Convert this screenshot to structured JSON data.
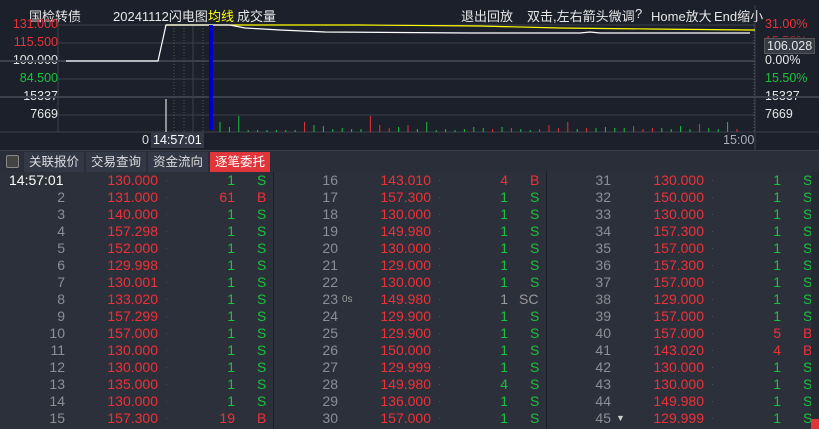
{
  "header": {
    "name": "国检转债",
    "date_title": "20241112闪电图",
    "avg_line_label": "均线",
    "volume_label": "成交量",
    "exit_replay": "退出回放",
    "hint": "双击,左右箭头微调",
    "help": "?",
    "zoom_in": "Home放大",
    "zoom_out": "End缩小"
  },
  "axis_left": [
    "131.000",
    "115.500",
    "100.000",
    "84.500",
    "15337",
    "7669"
  ],
  "axis_right": [
    "31.00%",
    "15.50%",
    "106.028",
    "0.00%",
    "15.50%",
    "15337",
    "7669"
  ],
  "time_axis": {
    "start": "0",
    "cursor": "14:57:01",
    "end": "15:00"
  },
  "colors": {
    "up": "#e8323a",
    "down": "#19c23c",
    "avg": "#ffff00",
    "price": "#ffffff",
    "cursor": "#0000cc"
  },
  "volumes": [
    [
      1,
      "g"
    ],
    [
      0.5,
      "g"
    ],
    [
      1.6,
      "g"
    ],
    [
      0.2,
      "g"
    ],
    [
      0.2,
      "g"
    ],
    [
      0.2,
      "g"
    ],
    [
      0.2,
      "g"
    ],
    [
      0.2,
      "g"
    ],
    [
      0.2,
      "g"
    ],
    [
      1.0,
      "r"
    ],
    [
      0.7,
      "g"
    ],
    [
      0.6,
      "g"
    ],
    [
      0.3,
      "g"
    ],
    [
      0.4,
      "g"
    ],
    [
      0.3,
      "g"
    ],
    [
      0.3,
      "g"
    ],
    [
      1.6,
      "r"
    ],
    [
      0.7,
      "r"
    ],
    [
      0.4,
      "r"
    ],
    [
      0.5,
      "g"
    ],
    [
      0.7,
      "r"
    ],
    [
      0.3,
      "g"
    ],
    [
      1.0,
      "g"
    ],
    [
      0.2,
      "g"
    ],
    [
      0.3,
      "g"
    ],
    [
      0.2,
      "g"
    ],
    [
      0.3,
      "g"
    ],
    [
      0.5,
      "g"
    ],
    [
      0.4,
      "g"
    ],
    [
      0.3,
      "r"
    ],
    [
      0.5,
      "g"
    ],
    [
      0.4,
      "r"
    ],
    [
      0.3,
      "g"
    ],
    [
      0.2,
      "g"
    ],
    [
      0.3,
      "r"
    ],
    [
      0.7,
      "r"
    ],
    [
      0.4,
      "r"
    ],
    [
      1.0,
      "r"
    ],
    [
      0.3,
      "g"
    ],
    [
      0.4,
      "r"
    ],
    [
      0.4,
      "g"
    ],
    [
      0.5,
      "g"
    ],
    [
      0.4,
      "g"
    ],
    [
      0.4,
      "g"
    ],
    [
      0.6,
      "r"
    ],
    [
      0.3,
      "r"
    ],
    [
      0.4,
      "r"
    ],
    [
      0.4,
      "g"
    ],
    [
      0.3,
      "g"
    ],
    [
      0.6,
      "g"
    ],
    [
      0.3,
      "g"
    ],
    [
      0.8,
      "r"
    ],
    [
      0.4,
      "g"
    ],
    [
      0.3,
      "g"
    ],
    [
      1.0,
      "g"
    ],
    [
      0.3,
      "r"
    ]
  ],
  "tabs": [
    {
      "label": "关联报价"
    },
    {
      "label": "交易查询"
    },
    {
      "label": "资金流向"
    },
    {
      "label": "逐笔委托",
      "active": true
    }
  ],
  "rows": [
    {
      "i": "14:57:01",
      "p": "130.000",
      "v": "1",
      "f": "S"
    },
    {
      "i": "2",
      "p": "131.000",
      "v": "61",
      "f": "B"
    },
    {
      "i": "3",
      "p": "140.000",
      "v": "1",
      "f": "S"
    },
    {
      "i": "4",
      "p": "157.298",
      "v": "1",
      "f": "S"
    },
    {
      "i": "5",
      "p": "152.000",
      "v": "1",
      "f": "S"
    },
    {
      "i": "6",
      "p": "129.998",
      "v": "1",
      "f": "S"
    },
    {
      "i": "7",
      "p": "130.001",
      "v": "1",
      "f": "S"
    },
    {
      "i": "8",
      "p": "133.020",
      "v": "1",
      "f": "S"
    },
    {
      "i": "9",
      "p": "157.299",
      "v": "1",
      "f": "S"
    },
    {
      "i": "10",
      "p": "157.000",
      "v": "1",
      "f": "S"
    },
    {
      "i": "11",
      "p": "130.000",
      "v": "1",
      "f": "S"
    },
    {
      "i": "12",
      "p": "130.000",
      "v": "1",
      "f": "S"
    },
    {
      "i": "13",
      "p": "135.000",
      "v": "1",
      "f": "S"
    },
    {
      "i": "14",
      "p": "130.000",
      "v": "1",
      "f": "S"
    },
    {
      "i": "15",
      "p": "157.300",
      "v": "19",
      "f": "B"
    },
    {
      "i": "16",
      "p": "143.010",
      "v": "4",
      "f": "B"
    },
    {
      "i": "17",
      "p": "157.300",
      "v": "1",
      "f": "S"
    },
    {
      "i": "18",
      "p": "130.000",
      "v": "1",
      "f": "S"
    },
    {
      "i": "19",
      "p": "149.980",
      "v": "1",
      "f": "S"
    },
    {
      "i": "20",
      "p": "130.000",
      "v": "1",
      "f": "S"
    },
    {
      "i": "21",
      "p": "129.000",
      "v": "1",
      "f": "S"
    },
    {
      "i": "22",
      "p": "130.000",
      "v": "1",
      "f": "S"
    },
    {
      "i": "23",
      "note": "0s",
      "p": "149.980",
      "v": "1",
      "f": "SC"
    },
    {
      "i": "24",
      "p": "129.900",
      "v": "1",
      "f": "S"
    },
    {
      "i": "25",
      "p": "129.900",
      "v": "1",
      "f": "S"
    },
    {
      "i": "26",
      "p": "150.000",
      "v": "1",
      "f": "S"
    },
    {
      "i": "27",
      "p": "129.999",
      "v": "1",
      "f": "S"
    },
    {
      "i": "28",
      "p": "149.980",
      "v": "4",
      "f": "S"
    },
    {
      "i": "29",
      "p": "136.000",
      "v": "1",
      "f": "S"
    },
    {
      "i": "30",
      "p": "157.000",
      "v": "1",
      "f": "S"
    },
    {
      "i": "31",
      "p": "130.000",
      "v": "1",
      "f": "S"
    },
    {
      "i": "32",
      "p": "150.000",
      "v": "1",
      "f": "S"
    },
    {
      "i": "33",
      "p": "130.000",
      "v": "1",
      "f": "S"
    },
    {
      "i": "34",
      "p": "157.300",
      "v": "1",
      "f": "S"
    },
    {
      "i": "35",
      "p": "157.000",
      "v": "1",
      "f": "S"
    },
    {
      "i": "36",
      "p": "157.300",
      "v": "1",
      "f": "S"
    },
    {
      "i": "37",
      "p": "157.000",
      "v": "1",
      "f": "S"
    },
    {
      "i": "38",
      "p": "129.000",
      "v": "1",
      "f": "S"
    },
    {
      "i": "39",
      "p": "157.000",
      "v": "1",
      "f": "S"
    },
    {
      "i": "40",
      "p": "157.000",
      "v": "5",
      "f": "B"
    },
    {
      "i": "41",
      "p": "143.020",
      "v": "4",
      "f": "B"
    },
    {
      "i": "42",
      "p": "130.000",
      "v": "1",
      "f": "S"
    },
    {
      "i": "43",
      "p": "130.000",
      "v": "1",
      "f": "S"
    },
    {
      "i": "44",
      "p": "149.980",
      "v": "1",
      "f": "S"
    },
    {
      "i": "45",
      "marker": "▼",
      "p": "129.999",
      "v": "1",
      "f": "S"
    }
  ]
}
